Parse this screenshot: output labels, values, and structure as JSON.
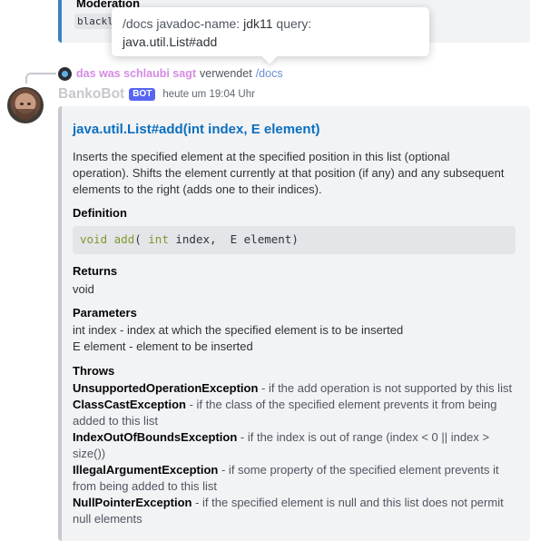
{
  "previous_message": {
    "field_name": "Moderation",
    "field_value": "blackl"
  },
  "tooltip": {
    "command": "/docs",
    "option1_name": "javadoc-name:",
    "option1_value": "jdk11",
    "option2_name": "query:",
    "option2_value": "java.util.List#add"
  },
  "reply": {
    "username": "das was schlaubi sagt",
    "action_text": "verwendet",
    "command": "/docs"
  },
  "message": {
    "username": "BankoBot",
    "badge": "BOT",
    "timestamp": "heute um 19:04 Uhr"
  },
  "embed": {
    "title": "java.util.List#add(int index, E element)",
    "description": "Inserts the specified element at the specified position in this list (optional operation). Shifts the element currently at that position (if any) and any subsequent elements to the right (adds one to their indices).",
    "definition_label": "Definition",
    "definition_code": {
      "return_type": "void",
      "method": "add",
      "open": "( ",
      "param_type": "int",
      "rest": " index,  E element)"
    },
    "returns_label": "Returns",
    "returns_value": "void",
    "parameters_label": "Parameters",
    "parameters": [
      "int index - index at which the specified element is to be inserted",
      "E element - element to be inserted"
    ],
    "throws_label": "Throws",
    "throws": [
      {
        "exception": "UnsupportedOperationException",
        "text": " - if the add operation is not supported by this list"
      },
      {
        "exception": "ClassCastException",
        "text": " - if the class of the specified element prevents it from being added to this list"
      },
      {
        "exception": "IndexOutOfBoundsException",
        "text": " - if the index is out of range (index < 0 || index > size())"
      },
      {
        "exception": "IllegalArgumentException",
        "text": " - if some property of the specified element prevents it from being added to this list"
      },
      {
        "exception": "NullPointerException",
        "text": " - if the specified element is null and this list does not permit null elements"
      }
    ]
  }
}
